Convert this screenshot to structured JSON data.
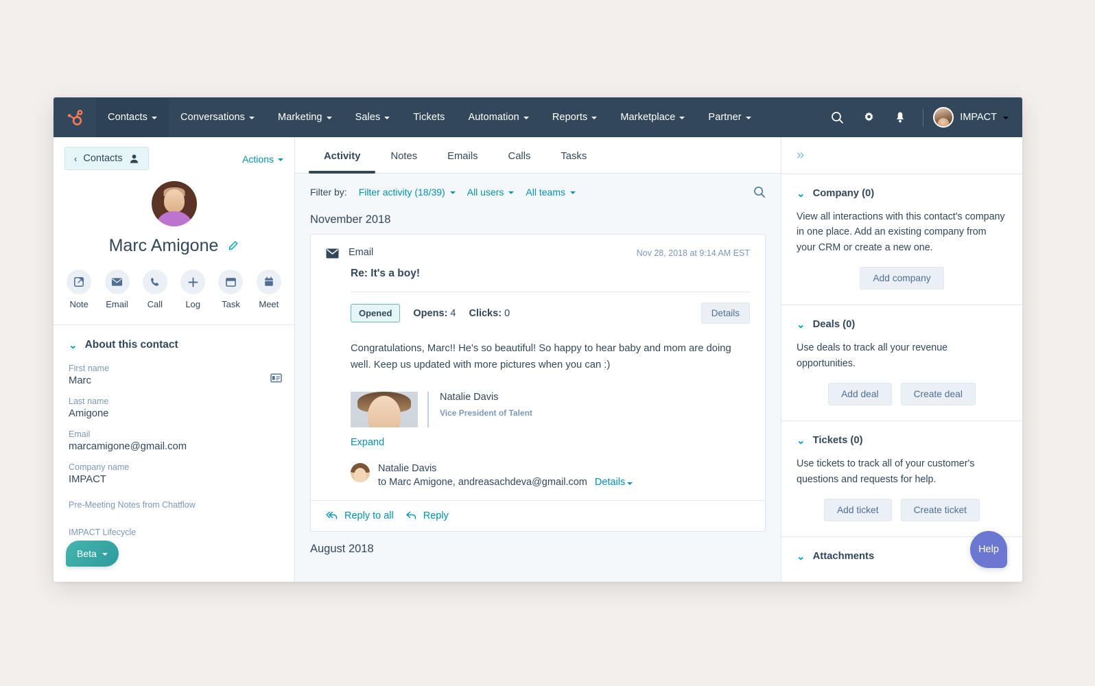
{
  "nav": {
    "logo_icon": "hubspot-sprocket-logo",
    "items": [
      {
        "label": "Contacts",
        "has_caret": true,
        "active": true
      },
      {
        "label": "Conversations",
        "has_caret": true,
        "active": false
      },
      {
        "label": "Marketing",
        "has_caret": true,
        "active": false
      },
      {
        "label": "Sales",
        "has_caret": true,
        "active": false
      },
      {
        "label": "Tickets",
        "has_caret": false,
        "active": false
      },
      {
        "label": "Automation",
        "has_caret": true,
        "active": false
      },
      {
        "label": "Reports",
        "has_caret": true,
        "active": false
      },
      {
        "label": "Marketplace",
        "has_caret": true,
        "active": false
      },
      {
        "label": "Partner",
        "has_caret": true,
        "active": false
      }
    ],
    "search_icon": "search-icon",
    "settings_icon": "gear-icon",
    "notifications_icon": "bell-icon",
    "account_name": "IMPACT"
  },
  "left": {
    "back_label": "Contacts",
    "back_icon": "contact-person-icon",
    "actions_label": "Actions",
    "contact_name": "Marc Amigone",
    "edit_icon": "pencil-icon",
    "quick_actions": [
      {
        "label": "Note",
        "icon": "note-icon"
      },
      {
        "label": "Email",
        "icon": "envelope-icon"
      },
      {
        "label": "Call",
        "icon": "phone-icon"
      },
      {
        "label": "Log",
        "icon": "plus-icon"
      },
      {
        "label": "Task",
        "icon": "task-icon"
      },
      {
        "label": "Meet",
        "icon": "calendar-icon"
      }
    ],
    "about_title": "About this contact",
    "fields": [
      {
        "label": "First name",
        "value": "Marc"
      },
      {
        "label": "Last name",
        "value": "Amigone"
      },
      {
        "label": "Email",
        "value": "marcamigone@gmail.com"
      },
      {
        "label": "Company name",
        "value": "IMPACT"
      }
    ],
    "extra_label_1": "Pre-Meeting Notes from Chatflow",
    "extra_label_2": "IMPACT Lifecycle",
    "card_icon": "contact-card-icon",
    "beta_label": "Beta"
  },
  "center": {
    "tabs": [
      {
        "label": "Activity",
        "active": true
      },
      {
        "label": "Notes",
        "active": false
      },
      {
        "label": "Emails",
        "active": false
      },
      {
        "label": "Calls",
        "active": false
      },
      {
        "label": "Tasks",
        "active": false
      }
    ],
    "filter_label": "Filter by:",
    "filters": [
      {
        "label": "Filter activity (18/39)"
      },
      {
        "label": "All users"
      },
      {
        "label": "All teams"
      }
    ],
    "search_icon": "search-icon",
    "month_heading": "November 2018",
    "month_heading_2": "August 2018",
    "email": {
      "type_label": "Email",
      "envelope_icon": "envelope-icon",
      "timestamp": "Nov 28, 2018 at 9:14 AM EST",
      "subject": "Re: It's a boy!",
      "status_badge": "Opened",
      "opens_label": "Opens:",
      "opens_value": "4",
      "clicks_label": "Clicks:",
      "clicks_value": "0",
      "details_button": "Details",
      "body": "Congratulations, Marc!! He's so beautiful! So happy to hear baby and mom are doing well. Keep us updated with more pictures when you can :)",
      "signature_name": "Natalie Davis",
      "signature_title": "Vice President of Talent",
      "expand_label": "Expand",
      "sender_name": "Natalie Davis",
      "sender_recipients": "to Marc Amigone, andreasachdeva@gmail.com",
      "sender_details": "Details",
      "reply_all_label": "Reply to all",
      "reply_label": "Reply"
    }
  },
  "right": {
    "collapse_icon": "double-chevron-right-icon",
    "panels": [
      {
        "title": "Company (0)",
        "desc": "View all interactions with this contact's company in one place. Add an existing company from your CRM or create a new one.",
        "buttons": [
          "Add company"
        ]
      },
      {
        "title": "Deals (0)",
        "desc": "Use deals to track all your revenue opportunities.",
        "buttons": [
          "Add deal",
          "Create deal"
        ]
      },
      {
        "title": "Tickets (0)",
        "desc": "Use tickets to track all of your customer's questions and requests for help.",
        "buttons": [
          "Add ticket",
          "Create ticket"
        ]
      }
    ],
    "attachments_title": "Attachments",
    "help_label": "Help"
  },
  "colors": {
    "nav_bg": "#33475b",
    "brand_orange": "#ff7a59",
    "link_teal": "#0091ae",
    "page_bg": "#f2efed",
    "center_bg": "#f5f8fa",
    "help_purple": "#6a78d1",
    "beta_teal": "#2e9a9e"
  }
}
